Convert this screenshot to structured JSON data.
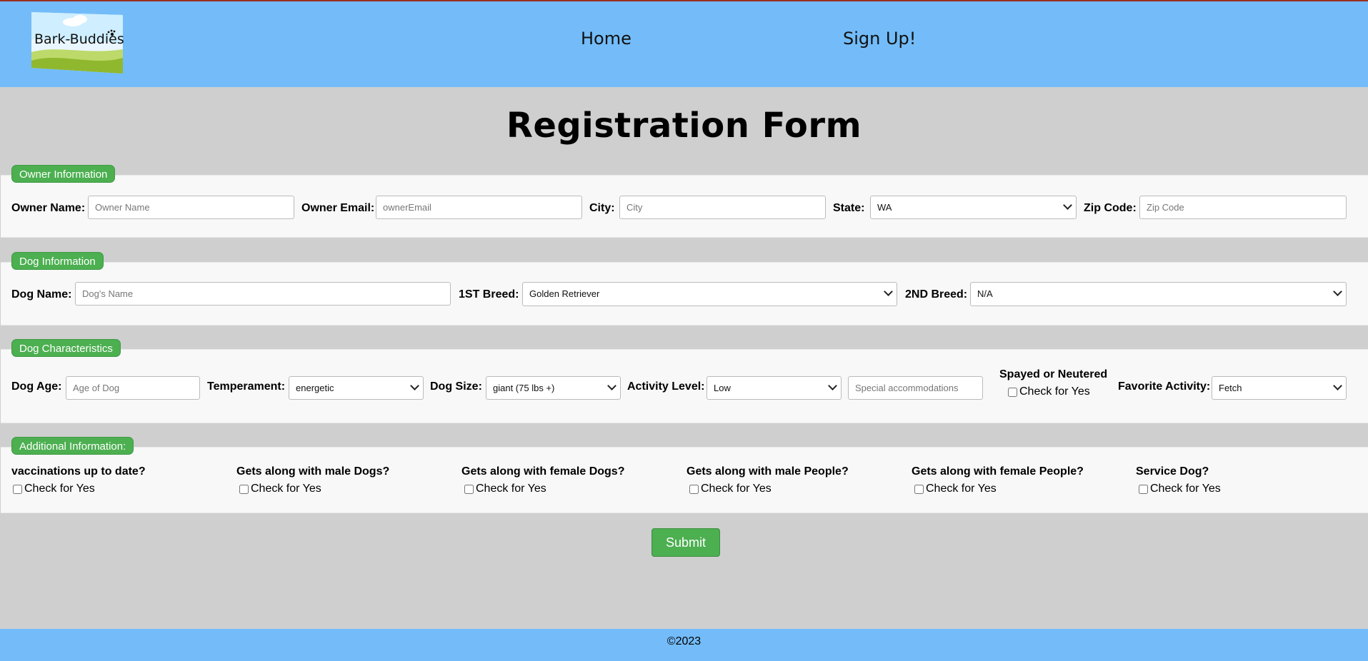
{
  "header": {
    "logo_text": "Bark-Buddies",
    "nav": {
      "home": "Home",
      "signup": "Sign Up!"
    }
  },
  "page_title": "Registration Form",
  "owner": {
    "legend": "Owner Information",
    "name_label": "Owner Name:",
    "name_placeholder": "Owner Name",
    "email_label": "Owner Email:",
    "email_placeholder": "ownerEmail",
    "city_label": "City:",
    "city_placeholder": "City",
    "state_label": "State:",
    "state_value": "WA",
    "zip_label": "Zip Code:",
    "zip_placeholder": "Zip Code"
  },
  "dog": {
    "legend": "Dog Information",
    "name_label": "Dog Name:",
    "name_placeholder": "Dog's Name",
    "breed1_label": "1ST Breed:",
    "breed1_value": "Golden Retriever",
    "breed2_label": "2ND Breed:",
    "breed2_value": "N/A"
  },
  "traits": {
    "legend": "Dog Characteristics",
    "age_label": "Dog Age:",
    "age_placeholder": "Age of Dog",
    "temperament_label": "Temperament:",
    "temperament_value": "energetic",
    "size_label": "Dog Size:",
    "size_value": "giant (75 lbs +)",
    "activity_label": "Activity Level:",
    "activity_value": "Low",
    "special_placeholder": "Special accommodations",
    "spayed_label": "Spayed or Neutered",
    "spayed_check": "Check for Yes",
    "favorite_label": "Favorite Activity:",
    "favorite_value": "Fetch"
  },
  "additional": {
    "legend": "Additional Information:",
    "items": [
      {
        "question": "vaccinations up to date?",
        "check": "Check for Yes"
      },
      {
        "question": "Gets along with male Dogs?",
        "check": "Check for Yes"
      },
      {
        "question": "Gets along with female Dogs?",
        "check": "Check for Yes"
      },
      {
        "question": "Gets along with male People?",
        "check": "Check for Yes"
      },
      {
        "question": "Gets along with female People?",
        "check": "Check for Yes"
      },
      {
        "question": "Service Dog?",
        "check": "Check for Yes"
      }
    ]
  },
  "submit_label": "Submit",
  "footer": {
    "copyright": "©2023"
  },
  "colors": {
    "header": "#73bcf9",
    "accent": "#4caf50",
    "background": "#cfcfcf"
  }
}
